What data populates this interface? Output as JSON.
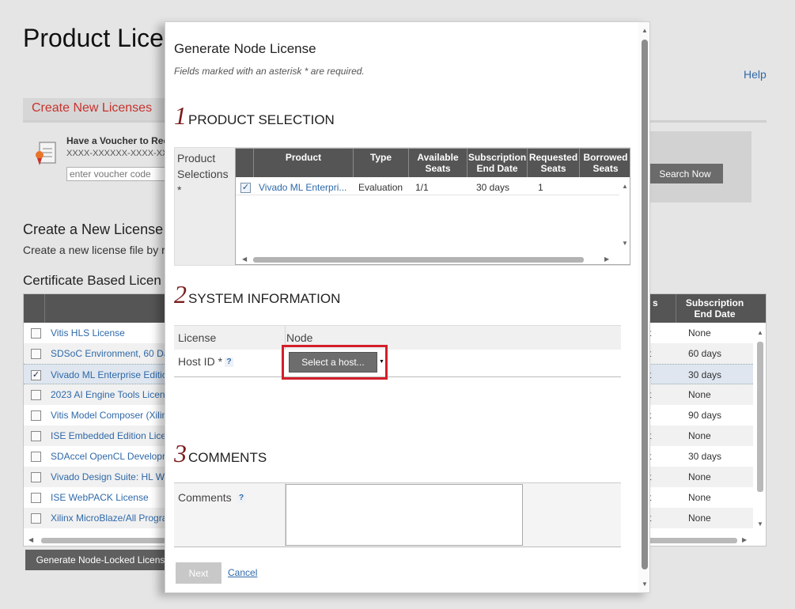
{
  "page": {
    "title": "Product Lice",
    "help_link": "Help",
    "tab_label": "Create New Licenses",
    "voucher": {
      "title": "Have a Voucher to Rec",
      "mask": "XXXX-XXXXXX-XXXX-XXXX",
      "placeholder": "enter voucher code",
      "search_button": "Search Now"
    },
    "create_heading": "Create a New License",
    "create_desc": "Create a new license file by r",
    "cert_heading": "Certificate Based Licen",
    "table": {
      "col_s": "s",
      "col_sub_end": "Subscription End Date",
      "rows": [
        {
          "name": "Vitis HLS License",
          "t": "t",
          "end": "None",
          "checked": false
        },
        {
          "name": "SDSoC Environment, 60 Da",
          "t": "t",
          "end": "60 days",
          "checked": false
        },
        {
          "name": "Vivado ML Enterprise Editic",
          "t": "t",
          "end": "30 days",
          "checked": true
        },
        {
          "name": "2023 AI Engine Tools Licen",
          "t": "t",
          "end": "None",
          "checked": false
        },
        {
          "name": "Vitis Model Composer (Xilin",
          "t": "t",
          "end": "90 days",
          "checked": false
        },
        {
          "name": "ISE Embedded Edition Lice",
          "t": "t",
          "end": "None",
          "checked": false
        },
        {
          "name": "SDAccel OpenCL Developr",
          "t": "t",
          "end": "30 days",
          "checked": false
        },
        {
          "name": "Vivado Design Suite: HL W",
          "t": "t",
          "end": "None",
          "checked": false
        },
        {
          "name": "ISE WebPACK License",
          "t": "t",
          "end": "None",
          "checked": false
        },
        {
          "name": "Xilinx MicroBlaze/All Progra",
          "t": "t",
          "end": "None",
          "checked": false
        }
      ]
    },
    "generate_button": "Generate Node-Locked Licens"
  },
  "modal": {
    "title": "Generate Node License",
    "required_note": "Fields marked with an asterisk * are required.",
    "step1": {
      "num": "1",
      "label": "PRODUCT SELECTION"
    },
    "product_selections_label": "Product Selections *",
    "grid": {
      "headers": {
        "product": "Product",
        "type": "Type",
        "available": "Available Seats",
        "sub_end": "Subscription End Date",
        "requested": "Requested Seats",
        "borrowed": "Borrowed Seats"
      },
      "row": {
        "checked": true,
        "product": "Vivado ML Enterpri...",
        "type": "Evaluation",
        "available": "1/1",
        "sub_end": "30 days",
        "requested": "1"
      }
    },
    "step2": {
      "num": "2",
      "label": "SYSTEM INFORMATION"
    },
    "system": {
      "license_label": "License",
      "license_value": "Node",
      "host_id_label": "Host ID *",
      "help_mark": "?",
      "select_host_button": "Select a host..."
    },
    "step3": {
      "num": "3",
      "label": "COMMENTS"
    },
    "comments": {
      "label": "Comments",
      "help_mark": "?",
      "value": ""
    },
    "next_button": "Next",
    "cancel_link": "Cancel"
  },
  "colors": {
    "accent_red": "#d3202a",
    "link_blue": "#2f69a9",
    "step_number": "#7b1d1d",
    "header_gray": "#555555"
  }
}
